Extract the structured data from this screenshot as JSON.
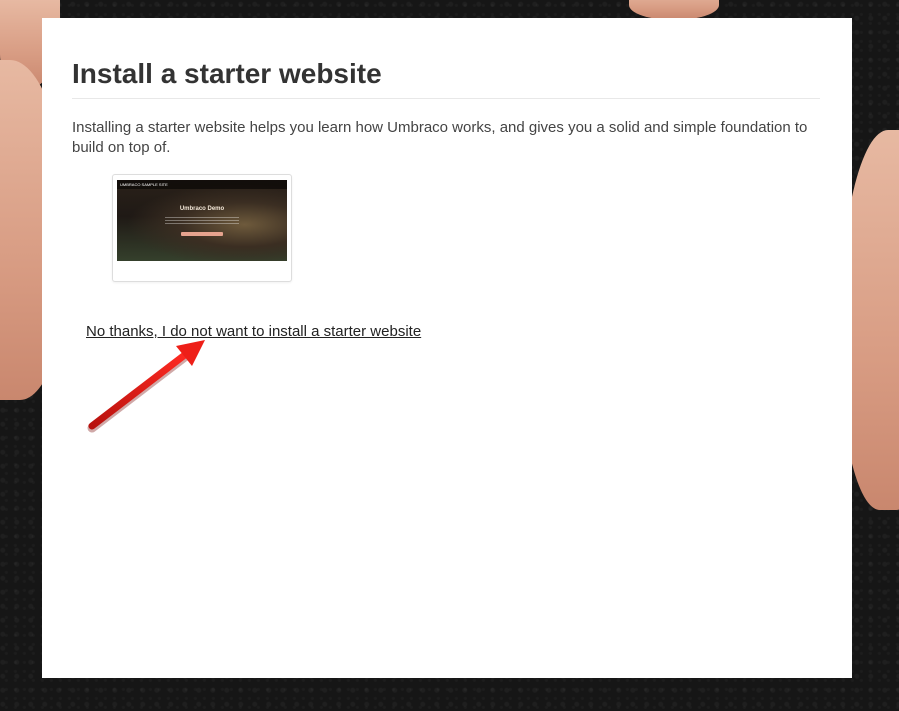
{
  "page": {
    "title": "Install a starter website",
    "description": "Installing a starter website helps you learn how Umbraco works, and gives you a solid and simple foundation to build on top of.",
    "starter_kit": {
      "thumbnail": {
        "site_name": "UMBRACO SAMPLE SITE",
        "headline": "Umbraco Demo"
      }
    },
    "skip_link": "No thanks, I do not want to install a starter website"
  },
  "colors": {
    "arrow": "#e0211b",
    "panel": "#ffffff",
    "text": "#333333"
  }
}
